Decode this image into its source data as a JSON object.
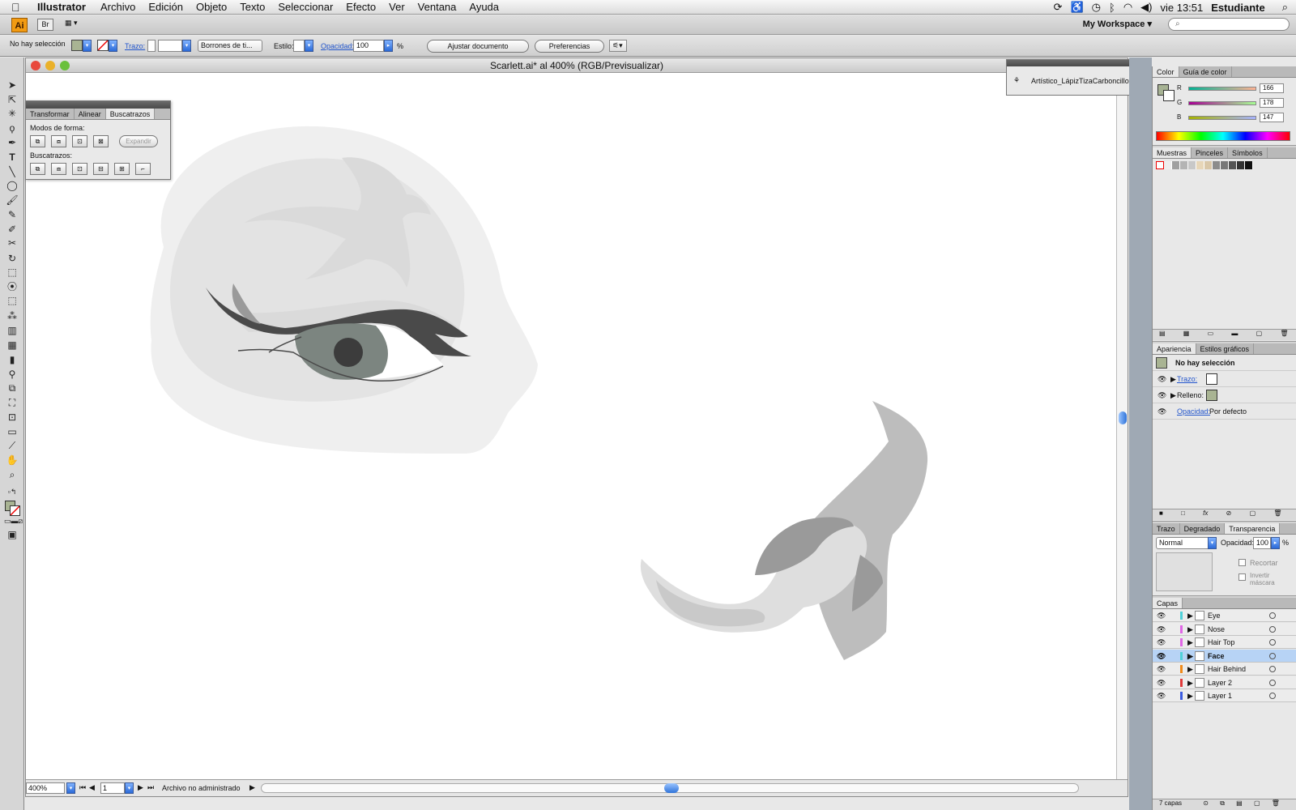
{
  "menubar": {
    "app_name": "Illustrator",
    "items": [
      "Archivo",
      "Edición",
      "Objeto",
      "Texto",
      "Seleccionar",
      "Efecto",
      "Ver",
      "Ventana",
      "Ayuda"
    ],
    "clock": "vie 13:51",
    "user": "Estudiante"
  },
  "appbar": {
    "app_logo": "Ai",
    "bridge": "Br",
    "workspace": "My Workspace ▾"
  },
  "controlbar": {
    "selection": "No hay selección",
    "stroke_label": "Trazo:",
    "brush": "Borrones de ti...",
    "style_label": "Estilo:",
    "opacity_label": "Opacidad:",
    "opacity_value": "100",
    "percent": "%",
    "fit_doc_button": "Ajustar documento",
    "prefs_button": "Preferencias",
    "fill_color": "#a9b493"
  },
  "document": {
    "title": "Scarlett.ai* al 400% (RGB/Previsualizar)",
    "zoom": "400%",
    "page": "1",
    "status": "Archivo no administrado",
    "colors": {
      "skin_light": "#efefef",
      "skin_mid": "#e3e3e3",
      "eyelid": "#dadada",
      "lash": "#4a4a4a",
      "iris": "#7c8580",
      "pupil": "#3c3c3c",
      "nose_dark": "#bdbdbd",
      "nose_light": "#dedede",
      "nostril": "#9a9a9a"
    }
  },
  "pathfinder": {
    "tabs": [
      "Transformar",
      "Alinear",
      "Buscatrazos"
    ],
    "shape_modes_label": "Modos de forma:",
    "expand_button": "Expandir",
    "pathfinders_label": "Buscatrazos:"
  },
  "brushpanel": {
    "brush_name": "Artístico_LápizTizaCarboncillo"
  },
  "color_panel": {
    "tabs": [
      "Color",
      "Guía de color"
    ],
    "r_label": "R",
    "r_value": "166",
    "g_label": "G",
    "g_value": "178",
    "b_label": "B",
    "b_value": "147"
  },
  "swatches_panel": {
    "tabs": [
      "Muestras",
      "Pinceles",
      "Símbolos"
    ]
  },
  "appearance_panel": {
    "tabs": [
      "Apariencia",
      "Estilos gráficos"
    ],
    "no_selection": "No hay selección",
    "stroke_label": "Trazo:",
    "fill_label": "Relleno:",
    "opacity_label": "Opacidad:",
    "opacity_value": "Por defecto"
  },
  "transparency_panel": {
    "tabs": [
      "Trazo",
      "Degradado",
      "Transparencia"
    ],
    "blend_mode": "Normal",
    "opacity_label": "Opacidad:",
    "opacity_value": "100",
    "percent": "%",
    "clip_label": "Recortar",
    "invert_label": "Invertir máscara"
  },
  "layers_panel": {
    "tab": "Capas",
    "layers": [
      {
        "name": "Eye",
        "color": "#4fd1d9"
      },
      {
        "name": "Nose",
        "color": "#e066e6"
      },
      {
        "name": "Hair Top",
        "color": "#e066e6"
      },
      {
        "name": "Face",
        "color": "#4fd1d9"
      },
      {
        "name": "Hair Behind",
        "color": "#f08a1a"
      },
      {
        "name": "Layer 2",
        "color": "#e03a3a"
      },
      {
        "name": "Layer 1",
        "color": "#3a5ae0"
      }
    ],
    "count": "7 capas"
  }
}
